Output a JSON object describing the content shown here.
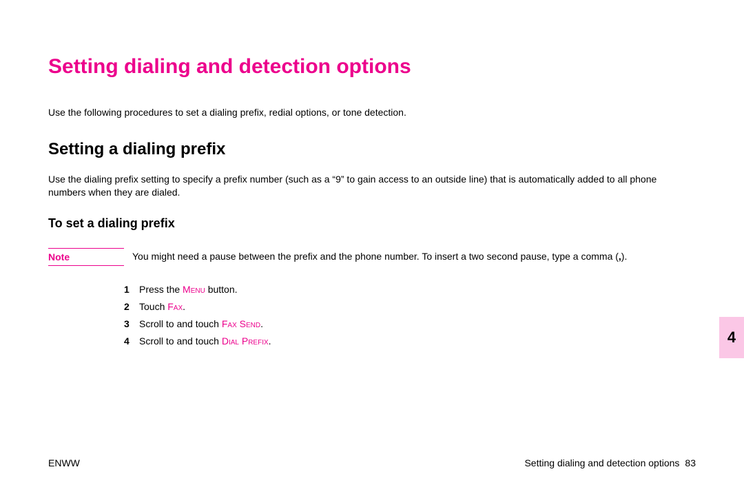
{
  "h1": "Setting dialing and detection options",
  "intro": "Use the following procedures to set a dialing prefix, redial options, or tone detection.",
  "h2": "Setting a dialing prefix",
  "p2": "Use the dialing prefix setting to specify a prefix number (such as a “9” to gain access to an outside line) that is automatically added to all phone numbers when they are dialed.",
  "h3": "To set a dialing prefix",
  "note_label": "Note",
  "note_text_a": "You might need a pause between the prefix and the phone number. To insert a two second pause, type a comma (",
  "note_text_b": ",",
  "note_text_c": ").",
  "steps": {
    "n1": "1",
    "s1a": "Press the ",
    "s1b": "Menu",
    "s1c": " button.",
    "n2": "2",
    "s2a": "Touch ",
    "s2b": "Fax",
    "s2c": ".",
    "n3": "3",
    "s3a": "Scroll to and touch ",
    "s3b": "Fax Send",
    "s3c": ".",
    "n4": "4",
    "s4a": "Scroll to and touch ",
    "s4b": "Dial Prefix",
    "s4c": "."
  },
  "tab": "4",
  "footer_left": "ENWW",
  "footer_right": "Setting dialing and detection options",
  "page_num": "83"
}
